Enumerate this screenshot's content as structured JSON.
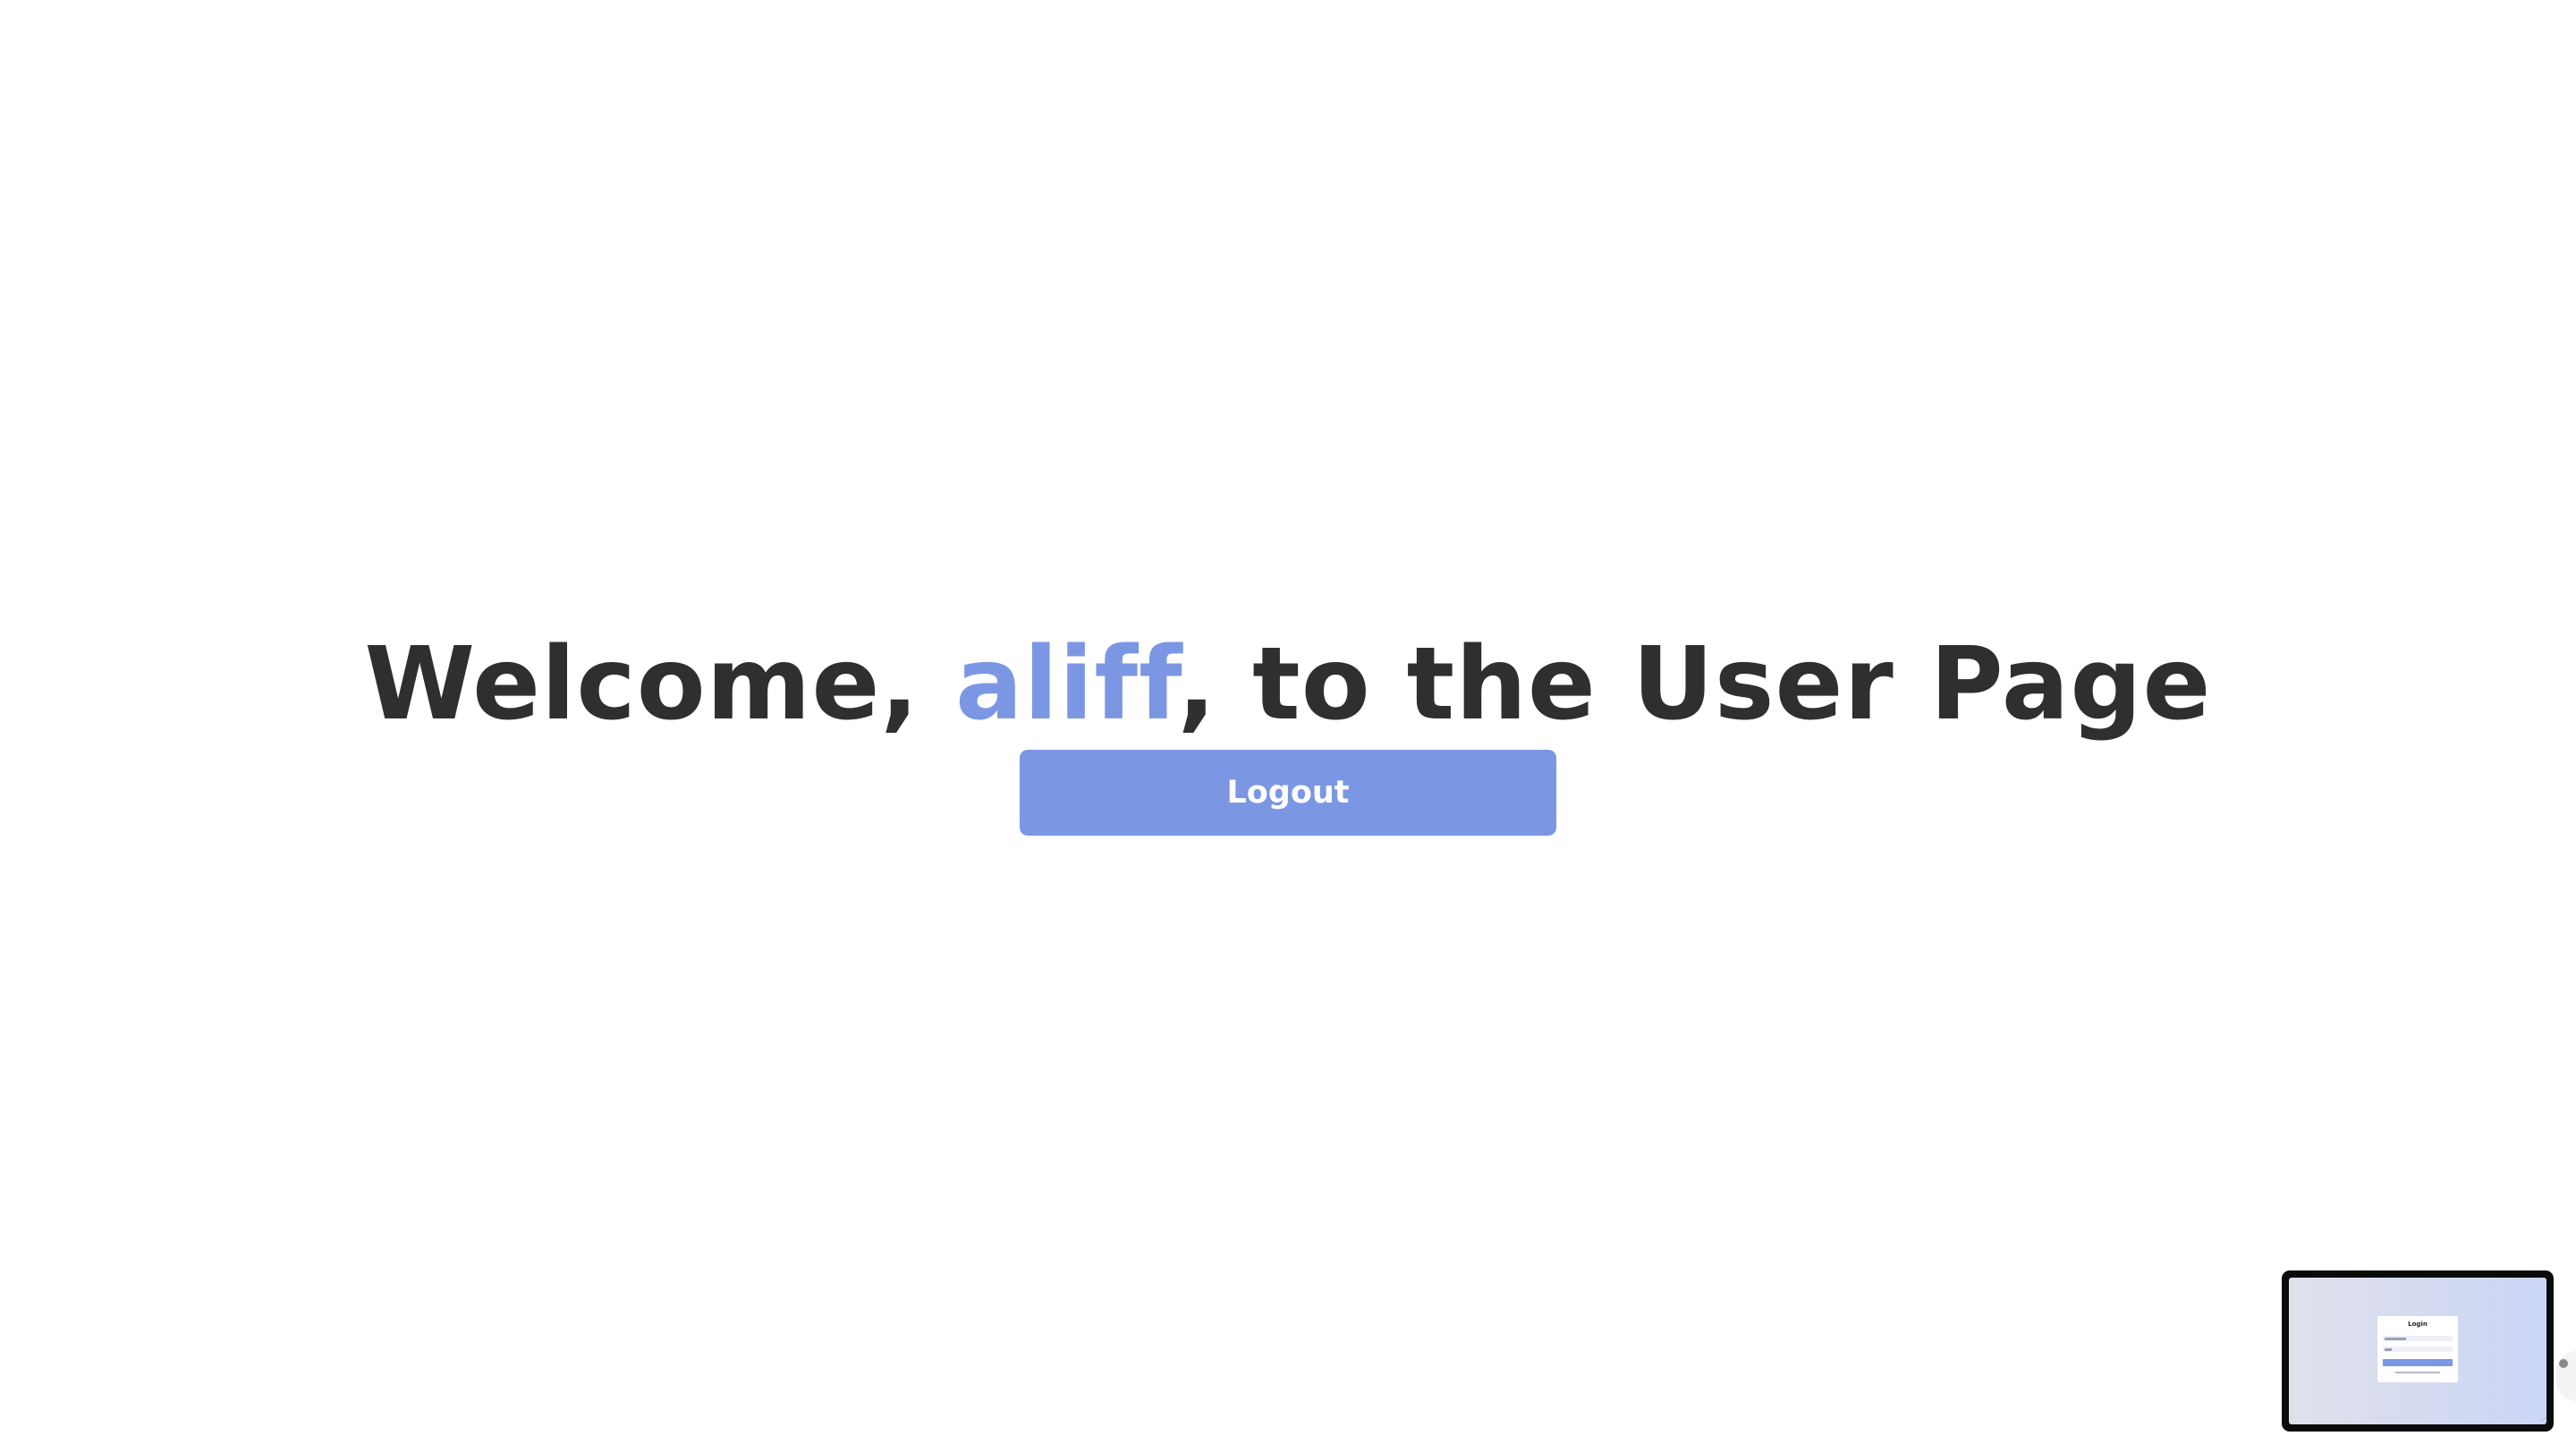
{
  "heading": {
    "prefix": "Welcome, ",
    "username": "aliff",
    "suffix": ", to the User Page"
  },
  "logout_button": {
    "label": "Logout"
  },
  "preview": {
    "card_title": "Login"
  },
  "colors": {
    "accent": "#7b97e4",
    "heading_text": "#2f2f2f",
    "background": "#ffffff"
  }
}
